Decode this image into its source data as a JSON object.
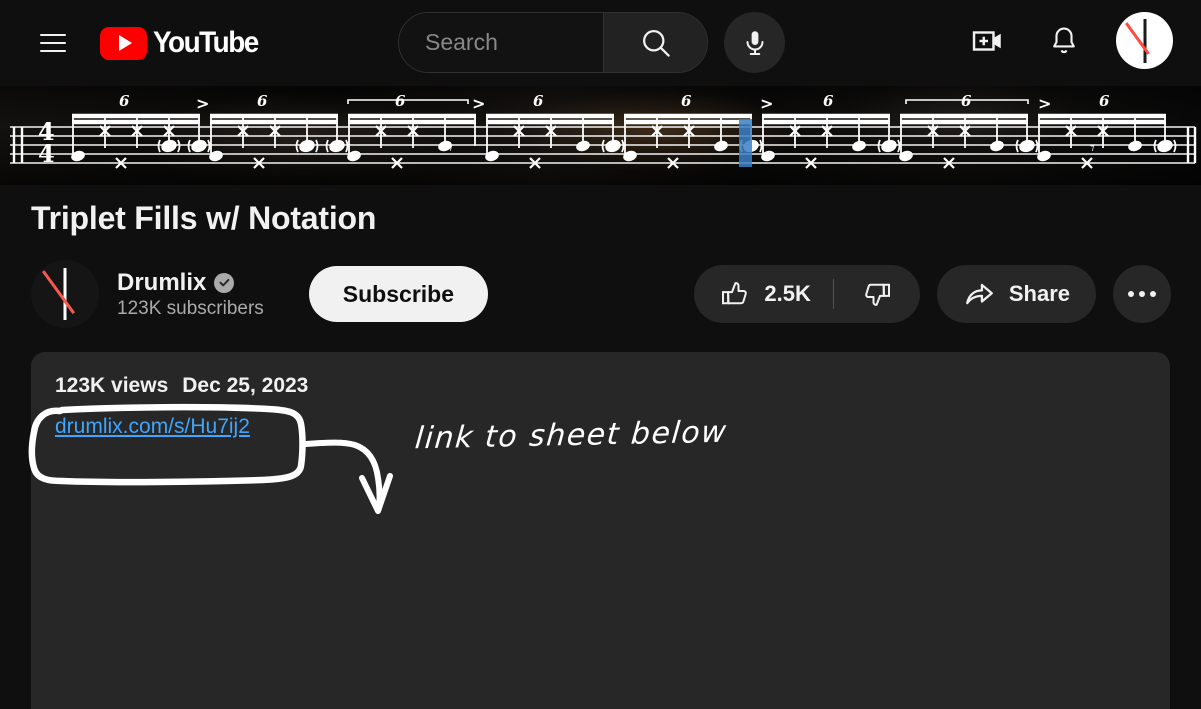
{
  "header": {
    "menu_icon": "hamburger-menu-icon",
    "logo_text": "YouTube",
    "logo_icon": "youtube-play-icon",
    "search": {
      "placeholder": "Search",
      "value": "",
      "search_icon": "search-icon",
      "mic_icon": "microphone-icon"
    },
    "create_icon": "create-video-icon",
    "notifications_icon": "bell-notifications-icon",
    "avatar_icon": "user-avatar-drumstick-icon"
  },
  "player": {
    "content": "drum-notation-overlay",
    "time_signature": "4/4",
    "tuplet_label": "6",
    "accent_label": ">",
    "cursor_color": "#3b7fc4"
  },
  "video": {
    "title": "Triplet Fills w/ Notation"
  },
  "channel": {
    "name": "Drumlix",
    "verified_badge": "verified-check-icon",
    "subscribers": "123K subscribers",
    "subscribe_label": "Subscribe",
    "avatar_icon": "channel-avatar-drumstick-icon"
  },
  "actions": {
    "like_icon": "thumbs-up-icon",
    "like_count": "2.5K",
    "dislike_icon": "thumbs-down-icon",
    "share_icon": "share-arrow-icon",
    "share_label": "Share",
    "more_icon": "more-options-icon"
  },
  "description": {
    "views": "123K views",
    "date": "Dec 25, 2023",
    "link": "drumlix.com/s/Hu7ij2"
  },
  "annotation": {
    "text": "link to sheet below",
    "circle_shape": "hand-drawn-circle-highlight",
    "arrow_shape": "hand-drawn-arrow",
    "ink_color": "#ffffff"
  },
  "colors": {
    "page_bg": "#0f0f0f",
    "surface": "#272727",
    "link_blue": "#3ea6ff",
    "brand_red": "#ff0000",
    "text_primary": "#f1f1f1",
    "text_secondary": "#aaaaaa"
  }
}
